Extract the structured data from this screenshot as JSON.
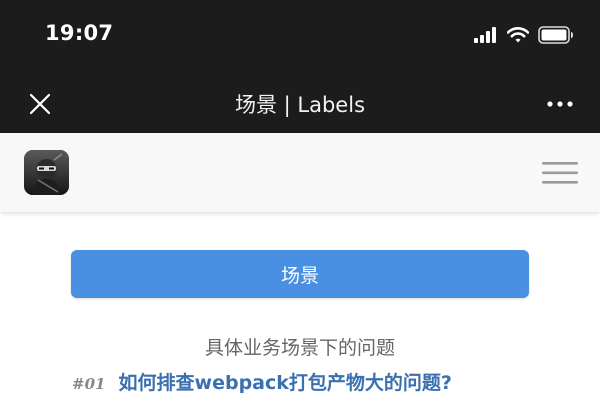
{
  "status_bar": {
    "time": "19:07",
    "icons": [
      "signal-icon",
      "wifi-icon",
      "battery-icon"
    ]
  },
  "nav_bar": {
    "title": "场景 | Labels",
    "close_icon": "close-icon",
    "more_icon": "more-icon"
  },
  "header": {
    "logo_icon": "ninja-logo-icon",
    "menu_icon": "hamburger-menu-icon"
  },
  "main": {
    "category_button_label": "场景",
    "subtitle": "具体业务场景下的问题",
    "articles": [
      {
        "number": "#01",
        "title": "如何排查webpack打包产物大的问题?"
      }
    ]
  },
  "colors": {
    "top_bar_bg": "#1c1c1c",
    "header_bg": "#f8f8f8",
    "button_bg": "#4a90e2",
    "link_color": "#3a6fb0",
    "subtitle_color": "#666666"
  }
}
